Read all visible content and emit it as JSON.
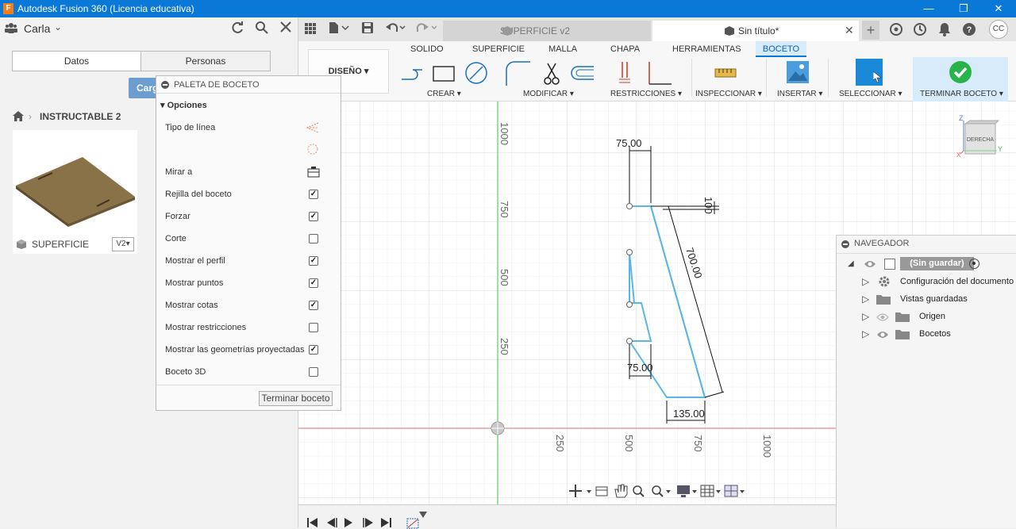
{
  "app": {
    "title": "Autodesk Fusion 360 (Licencia educativa)",
    "logo_letter": "F"
  },
  "window": {
    "min": "—",
    "restore": "❐",
    "close": "✕"
  },
  "user": {
    "name": "Carla",
    "initials": "CC"
  },
  "left_panel": {
    "tabs": [
      "Datos",
      "Personas"
    ],
    "load_button": "Cargar",
    "breadcrumb": "INSTRUCTABLE 2",
    "card": {
      "name": "SUPERFICIE",
      "version": "V2▾"
    }
  },
  "palette": {
    "title": "PALETA DE BOCETO",
    "section": "Opciones",
    "rows": [
      {
        "label": "Tipo de línea",
        "kind": "icon"
      },
      {
        "label": "",
        "kind": "icon2"
      },
      {
        "label": "Mirar a",
        "kind": "icon3"
      },
      {
        "label": "Rejilla del boceto",
        "kind": "check",
        "checked": true
      },
      {
        "label": "Forzar",
        "kind": "check",
        "checked": true
      },
      {
        "label": "Corte",
        "kind": "check",
        "checked": false
      },
      {
        "label": "Mostrar el perfil",
        "kind": "check",
        "checked": true
      },
      {
        "label": "Mostrar puntos",
        "kind": "check",
        "checked": true
      },
      {
        "label": "Mostrar cotas",
        "kind": "check",
        "checked": true
      },
      {
        "label": "Mostrar restricciones",
        "kind": "check",
        "checked": false
      },
      {
        "label": "Mostrar las geometrías proyectadas",
        "kind": "check",
        "checked": true
      },
      {
        "label": "Boceto 3D",
        "kind": "check",
        "checked": false
      }
    ],
    "finish": "Terminar boceto"
  },
  "doc_tabs": [
    {
      "label": "SUPERFICIE v2",
      "active": false
    },
    {
      "label": "Sin título*",
      "active": true
    }
  ],
  "ribbon": {
    "workspace": "DISEÑO",
    "tabs": [
      "SOLIDO",
      "SUPERFICIE",
      "MALLA",
      "CHAPA",
      "HERRAMIENTAS",
      "BOCETO"
    ],
    "active_tab": "BOCETO",
    "groups": [
      "CREAR",
      "MODIFICAR",
      "RESTRICCIONES",
      "INSPECCIONAR",
      "INSERTAR",
      "SELECCIONAR",
      "TERMINAR BOCETO"
    ]
  },
  "canvas": {
    "x_ticks": [
      "250",
      "500",
      "750",
      "1000"
    ],
    "y_ticks": [
      "1000",
      "750",
      "500",
      "250"
    ],
    "dims": {
      "top_width": "75.00",
      "top_offset": "100",
      "diag": "700.00",
      "mid_width": "75.00",
      "bottom_width": "135.00"
    },
    "view_cube": "DERECHA",
    "axis_labels": {
      "z": "Z",
      "y": "Y",
      "x": "X"
    }
  },
  "navigator": {
    "title": "NAVEGADOR",
    "root": "(Sin guardar)",
    "items": [
      "Configuración del documento",
      "Vistas guardadas",
      "Origen",
      "Bocetos"
    ]
  },
  "colors": {
    "accent": "#0a78d7",
    "sketch": "#5bb6e6",
    "finish": "#2ab34a"
  }
}
